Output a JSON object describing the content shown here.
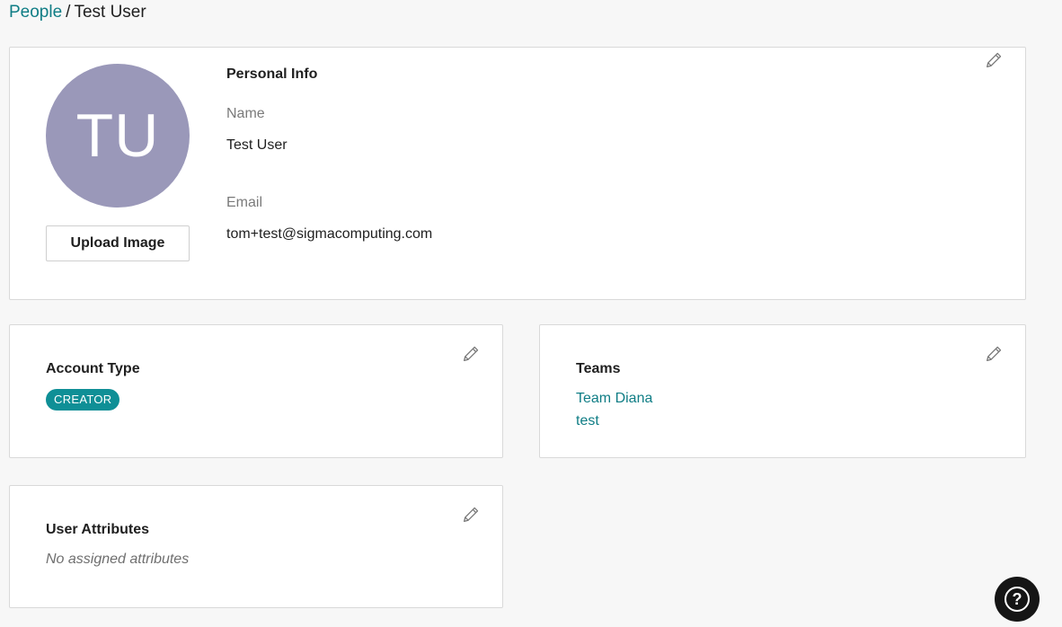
{
  "breadcrumb": {
    "parent": "People",
    "separator": "/",
    "current": "Test User"
  },
  "personal": {
    "title": "Personal Info",
    "avatar_initials": "TU",
    "upload_label": "Upload Image",
    "name_label": "Name",
    "name_value": "Test User",
    "email_label": "Email",
    "email_value": "tom+test@sigmacomputing.com"
  },
  "account": {
    "title": "Account Type",
    "badge": "CREATOR"
  },
  "teams": {
    "title": "Teams",
    "items": [
      "Team Diana",
      "test"
    ]
  },
  "attributes": {
    "title": "User Attributes",
    "empty_text": "No assigned attributes"
  },
  "help": {
    "glyph": "?"
  },
  "icons": {
    "edit": "pencil-icon",
    "help": "help-icon"
  },
  "colors": {
    "accent": "#0f7d85",
    "badge_bg": "#0f8f96",
    "avatar_bg": "#9a98b9",
    "help_bg": "#151515"
  }
}
